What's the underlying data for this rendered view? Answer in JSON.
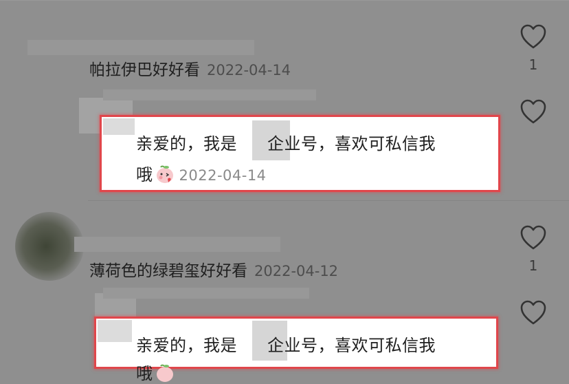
{
  "comments": [
    {
      "text": "帕拉伊巴好好看",
      "date": "2022-04-14",
      "like_count": "1",
      "reply": {
        "text_line1_a": "亲爱的，我是",
        "text_line1_b": "企业号，喜欢可私信我",
        "text_line2": "哦",
        "date": "2022-04-14"
      }
    },
    {
      "text": "薄荷色的绿碧玺好好看",
      "date": "2022-04-12",
      "like_count": "1",
      "reply": {
        "text_line1_a": "亲爱的，我是",
        "text_line1_b": "企业号，喜欢可私信我",
        "text_line2": "哦",
        "date": ""
      }
    }
  ],
  "icons": {
    "like": "heart-outline-icon",
    "emoji": "peach-blush-emoji-icon"
  },
  "colors": {
    "overlay_gray": "#8f8f8f",
    "highlight_border": "#e0464b",
    "card_bg": "#ffffff",
    "muted_text": "#8a8a8a"
  }
}
